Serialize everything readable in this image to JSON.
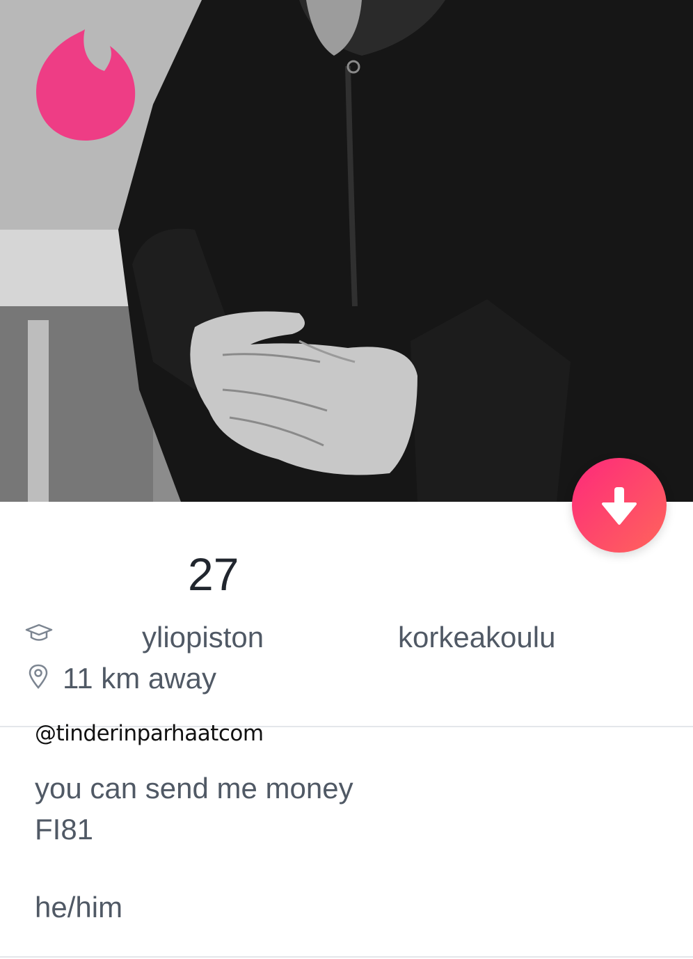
{
  "profile": {
    "age": "27",
    "school_primary": "yliopiston",
    "school_secondary": "korkeakoulu",
    "distance": "11 km away",
    "bio_line1": "you can send me money",
    "bio_line2": "FI81",
    "pronouns": "he/him"
  },
  "watermark": "@tinderinparhaatcom",
  "icons": {
    "logo": "tinder-flame-icon",
    "collapse": "arrow-down-icon",
    "school": "graduation-cap-icon",
    "location": "location-pin-icon"
  },
  "colors": {
    "brand_pink": "#fd297b",
    "brand_orange": "#ff655b",
    "text_dark": "#21262e",
    "text_gray": "#505965"
  }
}
